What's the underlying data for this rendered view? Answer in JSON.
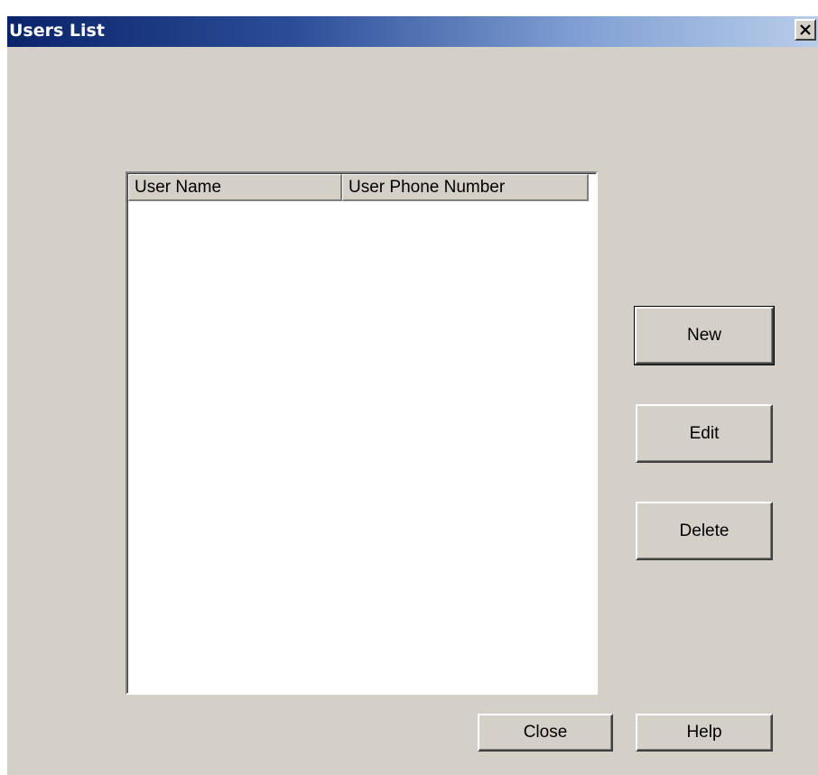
{
  "window": {
    "title": "Users List",
    "close_glyph": "✕"
  },
  "list": {
    "columns": [
      "User Name",
      "User Phone Number"
    ],
    "rows": []
  },
  "buttons": {
    "new": "New",
    "edit": "Edit",
    "delete": "Delete",
    "close": "Close",
    "help": "Help"
  },
  "colors": {
    "title_start": "#0a246a",
    "title_end": "#b8cdea",
    "face": "#d4d0c8"
  },
  "icons": {
    "close": "close-icon"
  }
}
